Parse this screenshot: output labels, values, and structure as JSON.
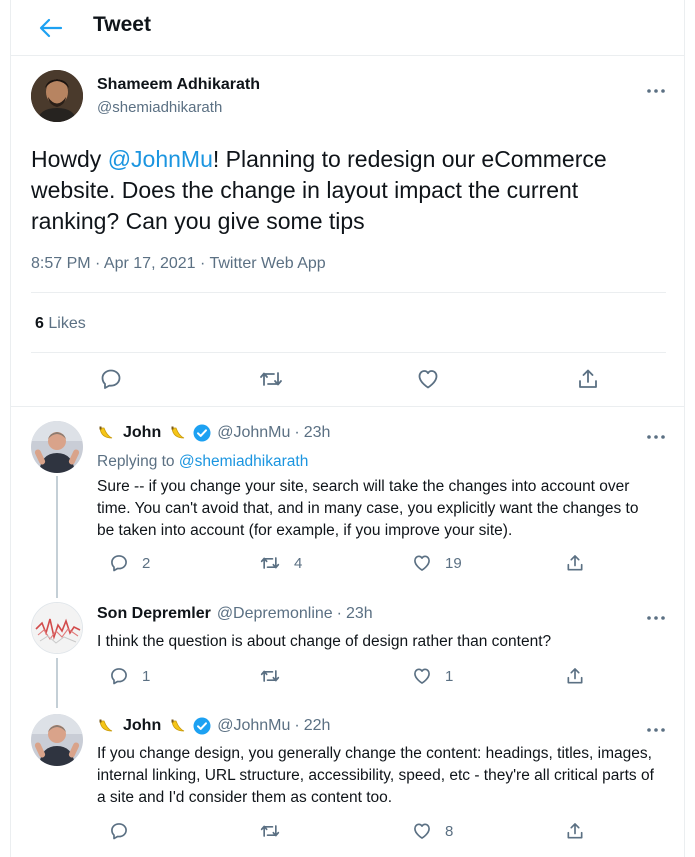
{
  "header": {
    "title": "Tweet"
  },
  "main_tweet": {
    "display_name": "Shameem Adhikarath",
    "handle": "@shemiadhikarath",
    "text_before": "Howdy ",
    "mention": "@JohnMu",
    "text_after": "! Planning to redesign our eCommerce website. Does the change in layout impact the current ranking? Can you give some tips",
    "meta": "8:57 PM · Apr 17, 2021 · Twitter Web App",
    "likes_count": "6",
    "likes_label": "Likes"
  },
  "replies": [
    {
      "display_name": "John",
      "handle": "@JohnMu",
      "separator": "·",
      "time": "23h",
      "replying_prefix": "Replying to",
      "replying_to": "@shemiadhikarath",
      "text": "Sure -- if you change your site, search will take the changes into account over time. You can't avoid that, and in many case, you explicitly want the changes to be taken into account (for example, if you improve your site).",
      "replies_count": "2",
      "retweets_count": "4",
      "likes_count": "19"
    },
    {
      "display_name": "Son Depremler",
      "handle": "@Depremonline",
      "separator": "·",
      "time": "23h",
      "text": "I think the question is about change of design rather than content?",
      "replies_count": "1",
      "retweets_count": "",
      "likes_count": "1"
    },
    {
      "display_name": "John",
      "handle": "@JohnMu",
      "separator": "·",
      "time": "22h",
      "text": "If you change design, you generally change the content: headings, titles, images, internal linking, URL structure, accessibility, speed, etc - they're all critical parts of a site and I'd consider them as content too.",
      "replies_count": "",
      "retweets_count": "",
      "likes_count": "8"
    }
  ],
  "colors": {
    "link": "#1b95e0",
    "muted": "#5b7083",
    "text": "#0f1419",
    "border": "#ebeef0"
  }
}
